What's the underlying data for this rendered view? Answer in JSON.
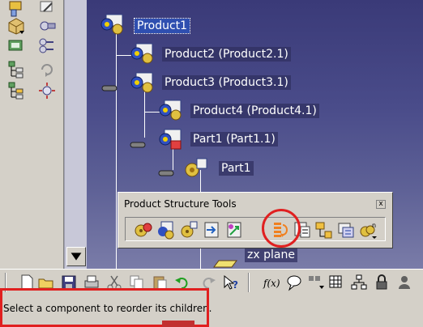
{
  "tree": {
    "nodes": [
      {
        "id": "product1",
        "label": "Product1",
        "selected": true,
        "icon": "product-icon"
      },
      {
        "id": "product2",
        "label": "Product2 (Product2.1)",
        "icon": "product-icon"
      },
      {
        "id": "product3",
        "label": "Product3 (Product3.1)",
        "icon": "product-icon"
      },
      {
        "id": "product4",
        "label": "Product4 (Product4.1)",
        "icon": "product-icon"
      },
      {
        "id": "part1-instance",
        "label": "Part1 (Part1.1)",
        "icon": "part-icon"
      },
      {
        "id": "part1",
        "label": "Part1",
        "icon": "part-body-icon"
      },
      {
        "id": "zx-plane",
        "label": "zx plane",
        "icon": "plane-icon"
      }
    ]
  },
  "product_structure_toolbar": {
    "title": "Product Structure Tools",
    "close_label": "x",
    "buttons": [
      "new-component-icon",
      "new-product-icon",
      "new-part-icon",
      "existing-component-icon",
      "replace-component-icon",
      "graph-tree-reordering-icon",
      "generate-numbering-icon",
      "selective-load-icon",
      "manage-representations-icon",
      "multi-instantiation-icon"
    ],
    "highlighted_button": "graph-tree-reordering-icon"
  },
  "status_bar": {
    "message": "Select a component to reorder its children."
  },
  "colors": {
    "highlight_red": "#e02020",
    "tree_background": "#4a4c8a",
    "selection_blue": "#2f4fb0"
  }
}
